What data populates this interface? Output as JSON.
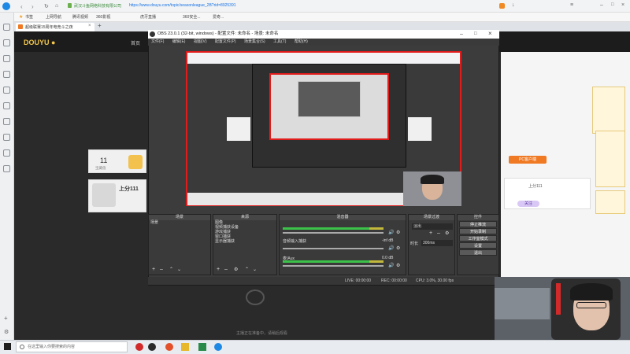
{
  "browser": {
    "url": "https://www.douyu.com/topic/seasonleague_2B?rid=8925391",
    "url_prefix": "武汉斗鱼网络科技有限公司",
    "bookmarks": [
      "书签",
      "上网导航",
      "腾讯视频",
      "360影视",
      "虎牙直播",
      "360安全...",
      "爱奇..."
    ],
    "tab_title": "超级联赛15周年电竞斗之夜",
    "new_tab_symbol": "+"
  },
  "page": {
    "nav_home": "首页",
    "bet_count": "11",
    "bet_label": "宝藏值",
    "live_label": "上分111",
    "pc_client": "PC客户端",
    "right_card_label": "上分111",
    "follow_button": "关注",
    "no_stream_text": "主播正在准备中，请稍后观看"
  },
  "obs": {
    "title": "OBS 23.0.1 (32-bit, windows) - 配置文件: 未命名 - 场景: 未命名",
    "menu": [
      "文件(F)",
      "编辑(E)",
      "视图(V)",
      "配置文件(P)",
      "场景集合(S)",
      "工具(T)",
      "帮助(H)"
    ],
    "scenes_header": "场景",
    "scenes": [
      "场景"
    ],
    "sources_header": "来源",
    "sources": [
      "图像",
      "视频捕获设备",
      "游戏捕获",
      "窗口捕获",
      "显示器捕获"
    ],
    "mixer_header": "混音器",
    "mixer_tracks": [
      {
        "name": "麦/Aux",
        "db": "0.0 dB"
      },
      {
        "name": "桌面音频",
        "db": "0.0 dB"
      },
      {
        "name": "音频输入捕获",
        "db": "-inf dB"
      }
    ],
    "transitions_header": "场景过渡",
    "transition_value": "淡出",
    "duration_label": "时长",
    "duration_value": "300ms",
    "controls_header": "控件",
    "controls": [
      "停止推流",
      "开始录制",
      "工作室模式",
      "设置",
      "退出"
    ],
    "status": {
      "live": "LIVE: 00:00:00",
      "rec": "REC: 00:00:00",
      "cpu": "CPU: 3.0%, 30.00 fps"
    }
  },
  "taskbar": {
    "search_placeholder": "在这里输入你要搜索的内容"
  }
}
